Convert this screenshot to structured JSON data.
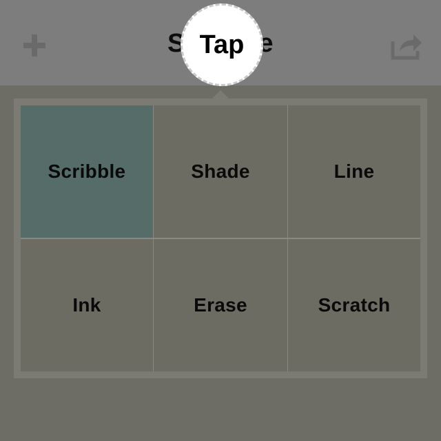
{
  "nav": {
    "title": "Scribble",
    "add_icon": "plus-icon",
    "share_icon": "share-icon"
  },
  "tap_hint": {
    "label": "Tap"
  },
  "brush_menu": {
    "items": [
      {
        "label": "Scribble",
        "selected": true
      },
      {
        "label": "Shade",
        "selected": false
      },
      {
        "label": "Line",
        "selected": false
      },
      {
        "label": "Ink",
        "selected": false
      },
      {
        "label": "Erase",
        "selected": false
      },
      {
        "label": "Scratch",
        "selected": false
      }
    ]
  },
  "colors": {
    "selected": "#566c69",
    "cell": "#6c6c62",
    "overlay": "#6d6d65"
  }
}
